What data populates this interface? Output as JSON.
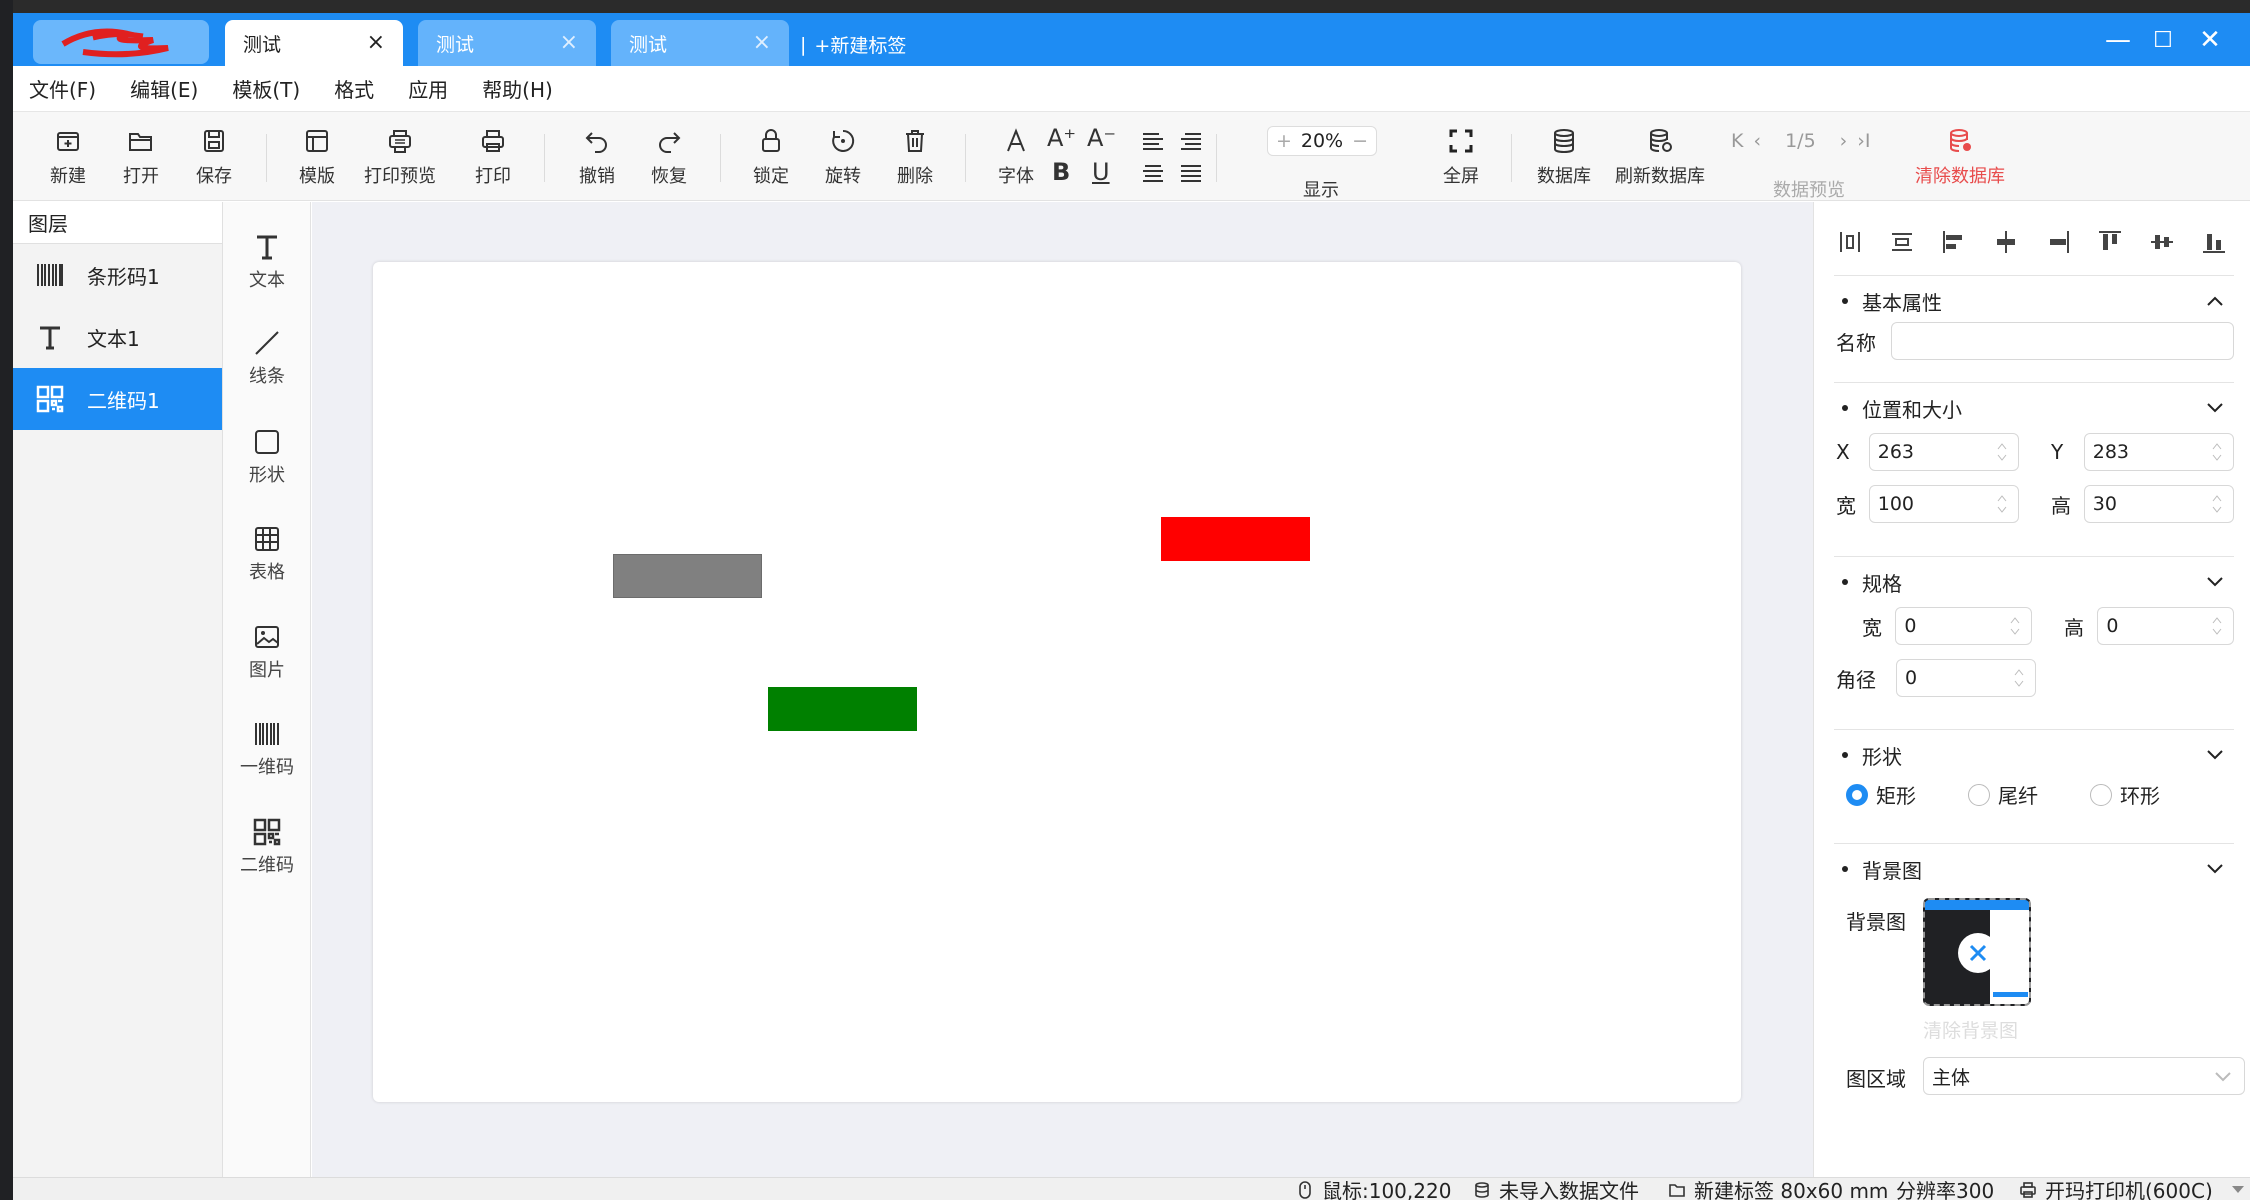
{
  "colors": {
    "accent": "#1e8cf3",
    "shape_gray": "#808080",
    "shape_red": "#ff0000",
    "shape_green": "#008000",
    "danger": "#e84c4c"
  },
  "tabs": [
    {
      "label": "测试",
      "close": "×",
      "active": true
    },
    {
      "label": "测试",
      "close": "×",
      "active": false
    },
    {
      "label": "测试",
      "close": "×",
      "active": false
    }
  ],
  "new_tab": {
    "sep": "|",
    "label": "+新建标签"
  },
  "window": {
    "minimize": "—",
    "maximize": "☐",
    "close": "✕"
  },
  "menu": [
    "文件(F)",
    "编辑(E)",
    "模板(T)",
    "格式",
    "应用",
    "帮助(H)"
  ],
  "toolbar": {
    "new": "新建",
    "open": "打开",
    "save": "保存",
    "template": "模版",
    "print_preview": "打印预览",
    "print": "打印",
    "undo": "撤销",
    "redo": "恢复",
    "lock": "锁定",
    "rotate": "旋转",
    "delete": "删除",
    "font": "字体",
    "font_bigger": "A⁺",
    "font_smaller": "A⁻",
    "bold": "B",
    "underline": "U",
    "zoom_plus": "+",
    "zoom_value": "20%",
    "zoom_minus": "−",
    "zoom_label": "显示",
    "fullscreen": "全屏",
    "database": "数据库",
    "refresh_db": "刷新数据库",
    "page_indicator": "1/5",
    "data_preview": "数据预览",
    "clear_db": "清除数据库"
  },
  "layers": {
    "header": "图层",
    "items": [
      {
        "label": "条形码1",
        "icon": "barcode-icon",
        "selected": false
      },
      {
        "label": "文本1",
        "icon": "text-icon",
        "selected": false
      },
      {
        "label": "二维码1",
        "icon": "qrcode-icon",
        "selected": true
      }
    ]
  },
  "tools": [
    {
      "label": "文本",
      "icon": "text-tool-icon"
    },
    {
      "label": "线条",
      "icon": "line-tool-icon"
    },
    {
      "label": "形状",
      "icon": "shape-tool-icon"
    },
    {
      "label": "表格",
      "icon": "table-tool-icon"
    },
    {
      "label": "图片",
      "icon": "image-tool-icon"
    },
    {
      "label": "一维码",
      "icon": "barcode-tool-icon"
    },
    {
      "label": "二维码",
      "icon": "qrcode-tool-icon"
    }
  ],
  "props": {
    "basic": {
      "title": "基本属性",
      "name_label": "名称",
      "name_value": ""
    },
    "position": {
      "title": "位置和大小",
      "x_label": "X",
      "x": "263",
      "y_label": "Y",
      "y": "283",
      "w_label": "宽",
      "w": "100",
      "h_label": "高",
      "h": "30"
    },
    "spec": {
      "title": "规格",
      "w_label": "宽",
      "w": "0",
      "h_label": "高",
      "h": "0",
      "radius_label": "角径",
      "radius": "0"
    },
    "shape": {
      "title": "形状",
      "options": [
        {
          "label": "矩形",
          "checked": true
        },
        {
          "label": "尾纤",
          "checked": false
        },
        {
          "label": "环形",
          "checked": false
        }
      ]
    },
    "background": {
      "title": "背景图",
      "label": "背景图",
      "clear": "清除背景图",
      "area_label": "图区域",
      "area_value": "主体"
    }
  },
  "status": {
    "mouse": "鼠标:100,220",
    "datafile": "未导入数据文件",
    "label_info": "新建标签 80x60 mm",
    "resolution": "分辨率300",
    "printer": "开玛打印机(600C)"
  }
}
